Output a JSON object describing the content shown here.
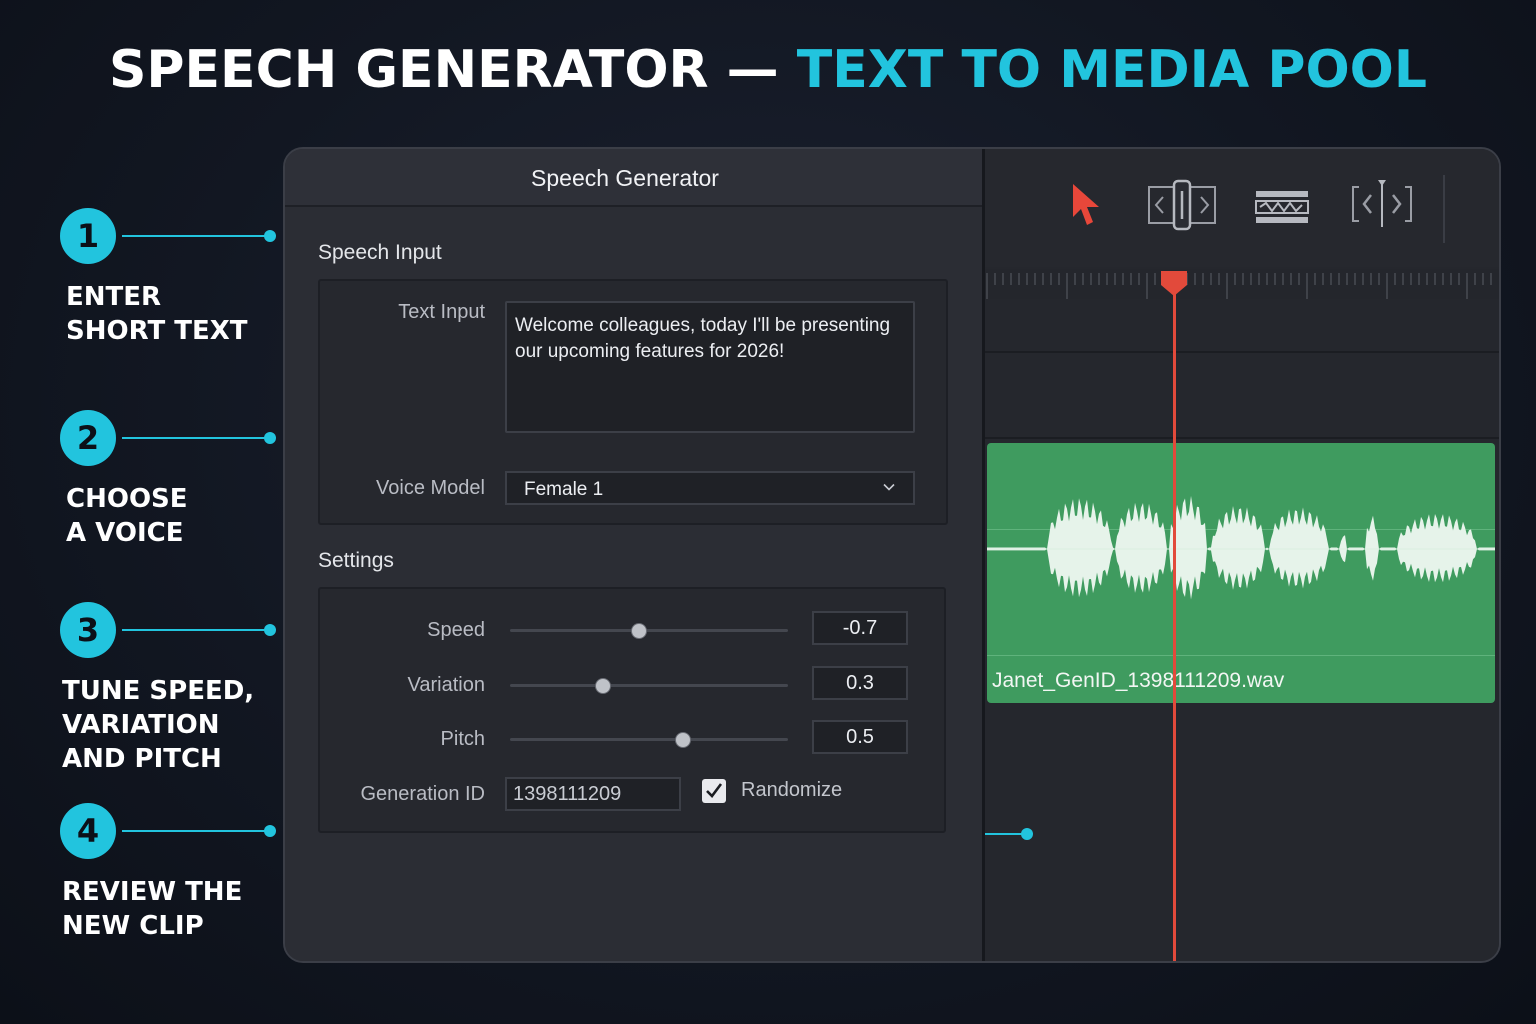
{
  "headline": {
    "main": "SPEECH GENERATOR — ",
    "accent": "TEXT TO MEDIA POOL"
  },
  "colors": {
    "accent": "#22c4de",
    "clip": "#3f9b5f",
    "playhead": "#e24a3b",
    "tool_active": "#e8473a"
  },
  "steps": [
    {
      "number": "1",
      "label": "ENTER\nSHORT TEXT"
    },
    {
      "number": "2",
      "label": "CHOOSE\nA VOICE"
    },
    {
      "number": "3",
      "label": "TUNE SPEED,\nVARIATION\nAND PITCH"
    },
    {
      "number": "4",
      "label": "REVIEW THE\nNEW CLIP"
    }
  ],
  "panel": {
    "title": "Speech Generator",
    "speech_input": {
      "section_label": "Speech Input",
      "text_input_label": "Text Input",
      "text_input_value": "Welcome colleagues, today I'll be presenting our upcoming features for 2026!",
      "voice_model_label": "Voice Model",
      "voice_model_value": "Female 1"
    },
    "settings": {
      "section_label": "Settings",
      "speed": {
        "label": "Speed",
        "value": "-0.7",
        "slider_fraction": 0.46
      },
      "variation": {
        "label": "Variation",
        "value": "0.3",
        "slider_fraction": 0.33
      },
      "pitch": {
        "label": "Pitch",
        "value": "0.5",
        "slider_fraction": 0.62
      },
      "generation_id_label": "Generation ID",
      "generation_id_value": "1398111209",
      "randomize_label": "Randomize",
      "randomize_checked": true
    }
  },
  "timeline": {
    "tools": [
      "selection-arrow-icon",
      "trim-icon",
      "blade-icon",
      "slip-icon"
    ],
    "clip_name": "Janet_GenID_1398111209.wav"
  }
}
